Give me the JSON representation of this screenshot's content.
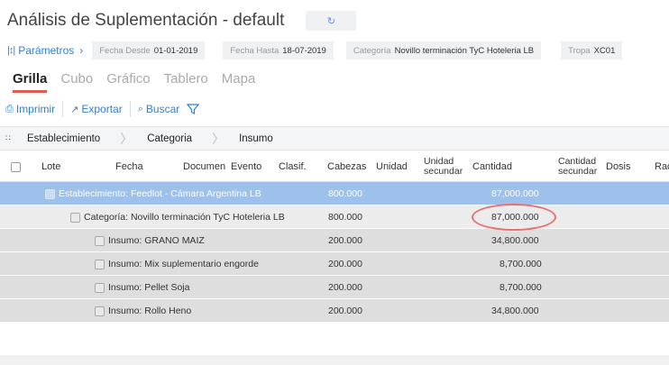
{
  "header": {
    "title": "Análisis de Suplementación - default",
    "refresh_icon": "refresh-icon"
  },
  "params": {
    "toggle_label": "Parámetros",
    "filters": [
      {
        "label": "Fecha Desde",
        "value": "01-01-2019"
      },
      {
        "label": "Fecha Hasta",
        "value": "18-07-2019"
      },
      {
        "label": "Categoría",
        "value": "Novillo terminación TyC Hoteleria LB"
      },
      {
        "label": "Tropa",
        "value": "XC01"
      }
    ]
  },
  "tabs": [
    {
      "label": "Grilla",
      "active": true
    },
    {
      "label": "Cubo",
      "active": false
    },
    {
      "label": "Gráfico",
      "active": false
    },
    {
      "label": "Tablero",
      "active": false
    },
    {
      "label": "Mapa",
      "active": false
    }
  ],
  "toolbar": {
    "print_label": "Imprimir",
    "export_label": "Exportar",
    "search_label": "Buscar"
  },
  "grouping": [
    "Establecimiento",
    "Categoria",
    "Insumo"
  ],
  "columns": [
    {
      "label": "Lote"
    },
    {
      "label": "Fecha"
    },
    {
      "label": "Documen"
    },
    {
      "label": "Evento"
    },
    {
      "label": "Clasif."
    },
    {
      "label": "Cabezas"
    },
    {
      "label": "Unidad"
    },
    {
      "label": "Unidad secundar"
    },
    {
      "label": "Cantidad"
    },
    {
      "label": "Cantidad secundar"
    },
    {
      "label": "Dosis"
    },
    {
      "label": "Rac"
    }
  ],
  "rows": [
    {
      "level": 0,
      "label": "Establecimiento: Feedlot - Cámara Argentina LB",
      "cabezas": "800.000",
      "cantidad": "87,000.000"
    },
    {
      "level": 1,
      "label": "Categoría: Novillo terminación TyC Hoteleria LB",
      "cabezas": "800.000",
      "cantidad": "87,000.000"
    },
    {
      "level": 2,
      "label": "Insumo: GRANO MAIZ",
      "cabezas": "200.000",
      "cantidad": "34,800.000"
    },
    {
      "level": 2,
      "label": "Insumo: Mix suplementario engorde",
      "cabezas": "200.000",
      "cantidad": "8,700.000"
    },
    {
      "level": 2,
      "label": "Insumo: Pellet Soja",
      "cabezas": "200.000",
      "cantidad": "8,700.000"
    },
    {
      "level": 2,
      "label": "Insumo: Rollo Heno",
      "cabezas": "200.000",
      "cantidad": "34,800.000"
    }
  ],
  "colors": {
    "accent": "#2f7fd6",
    "tab_underline": "#e05c4f",
    "selected_row": "#9dc1ea",
    "highlight": "#e57373"
  }
}
